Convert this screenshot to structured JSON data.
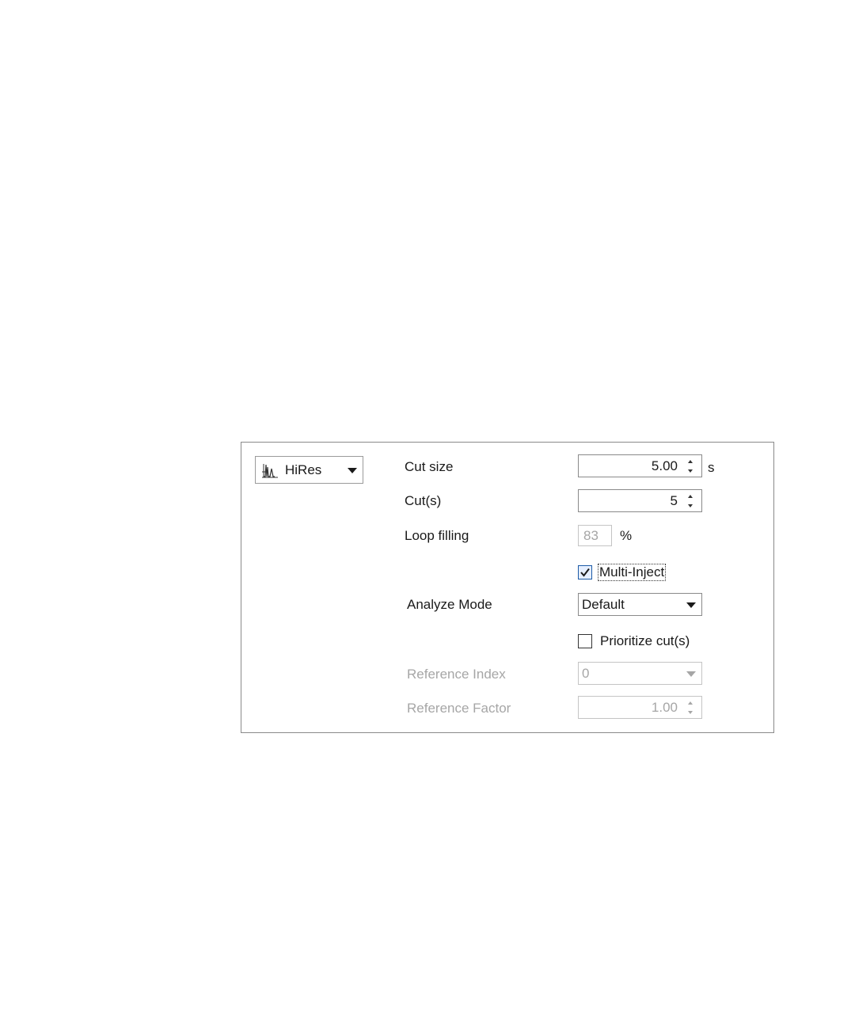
{
  "mode_dropdown": {
    "icon": "chromatogram-peaks-icon",
    "selected": "HiRes"
  },
  "fields": {
    "cut_size": {
      "label": "Cut size",
      "value": "5.00",
      "unit": "s"
    },
    "cuts": {
      "label": "Cut(s)",
      "value": "5"
    },
    "loop_filling": {
      "label": "Loop filling",
      "value": "83",
      "unit": "%"
    },
    "multi_inject": {
      "label": "Multi-Inject",
      "checked": true
    },
    "analyze_mode": {
      "label": "Analyze Mode",
      "selected": "Default"
    },
    "prioritize_cuts": {
      "label": "Prioritize cut(s)",
      "checked": false
    },
    "reference_index": {
      "label": "Reference Index",
      "selected": "0"
    },
    "reference_factor": {
      "label": "Reference Factor",
      "value": "1.00"
    }
  },
  "colors": {
    "disabled_text": "#a6a6a6",
    "border": "#8a8a8a",
    "checkbox_accent": "#1c5aa6"
  }
}
